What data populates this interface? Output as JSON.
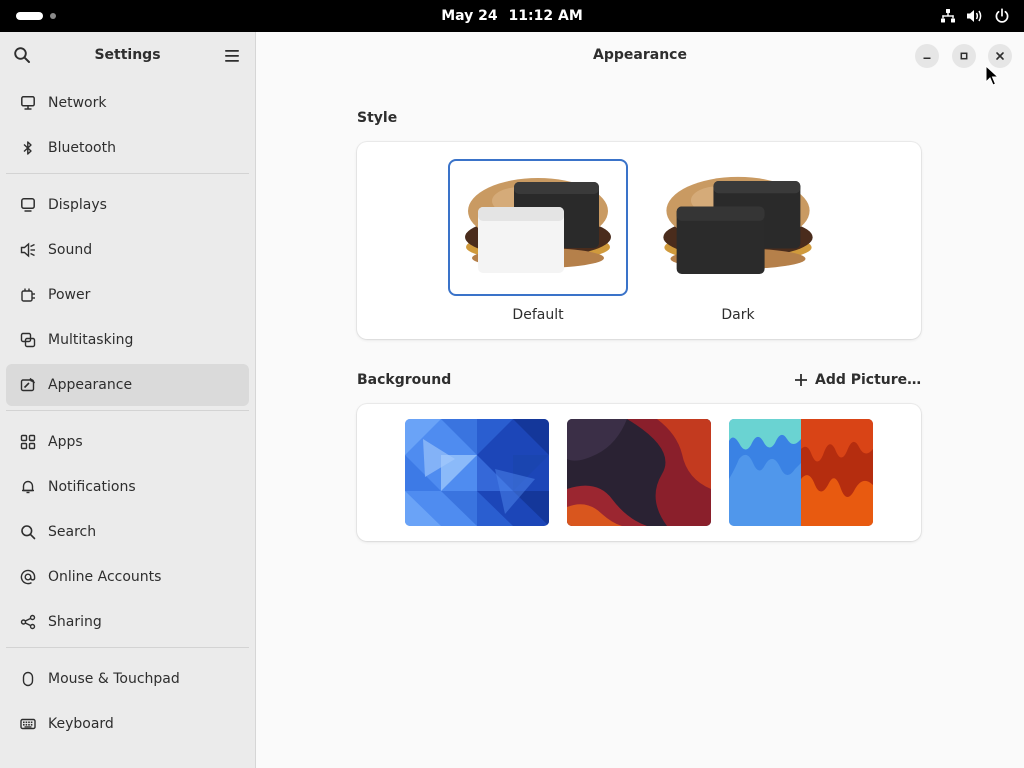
{
  "topbar": {
    "date": "May 24",
    "time": "11:12 AM"
  },
  "sidebar": {
    "title": "Settings",
    "items": [
      {
        "label": "Network",
        "icon": "network-icon"
      },
      {
        "label": "Bluetooth",
        "icon": "bluetooth-icon"
      },
      {
        "label": "Displays",
        "icon": "display-icon"
      },
      {
        "label": "Sound",
        "icon": "speaker-icon"
      },
      {
        "label": "Power",
        "icon": "power-plug-icon"
      },
      {
        "label": "Multitasking",
        "icon": "multitasking-icon"
      },
      {
        "label": "Appearance",
        "icon": "appearance-icon",
        "active": true
      },
      {
        "label": "Apps",
        "icon": "apps-grid-icon"
      },
      {
        "label": "Notifications",
        "icon": "bell-icon"
      },
      {
        "label": "Search",
        "icon": "search-icon"
      },
      {
        "label": "Online Accounts",
        "icon": "at-sign-icon"
      },
      {
        "label": "Sharing",
        "icon": "share-icon"
      },
      {
        "label": "Mouse & Touchpad",
        "icon": "mouse-icon"
      },
      {
        "label": "Keyboard",
        "icon": "keyboard-icon"
      }
    ]
  },
  "main": {
    "title": "Appearance",
    "style_section": {
      "label": "Style",
      "options": [
        {
          "label": "Default",
          "selected": true
        },
        {
          "label": "Dark",
          "selected": false
        }
      ]
    },
    "background_section": {
      "label": "Background",
      "add_picture_label": "Add Picture…",
      "wallpapers": [
        "blue-triangles",
        "dark-amber-waves",
        "blue-orange-drips"
      ]
    }
  },
  "colors": {
    "accent": "#3a73c9",
    "sidebar_bg": "#ebebeb",
    "main_bg": "#fafafa",
    "topbar_bg": "#000000"
  }
}
